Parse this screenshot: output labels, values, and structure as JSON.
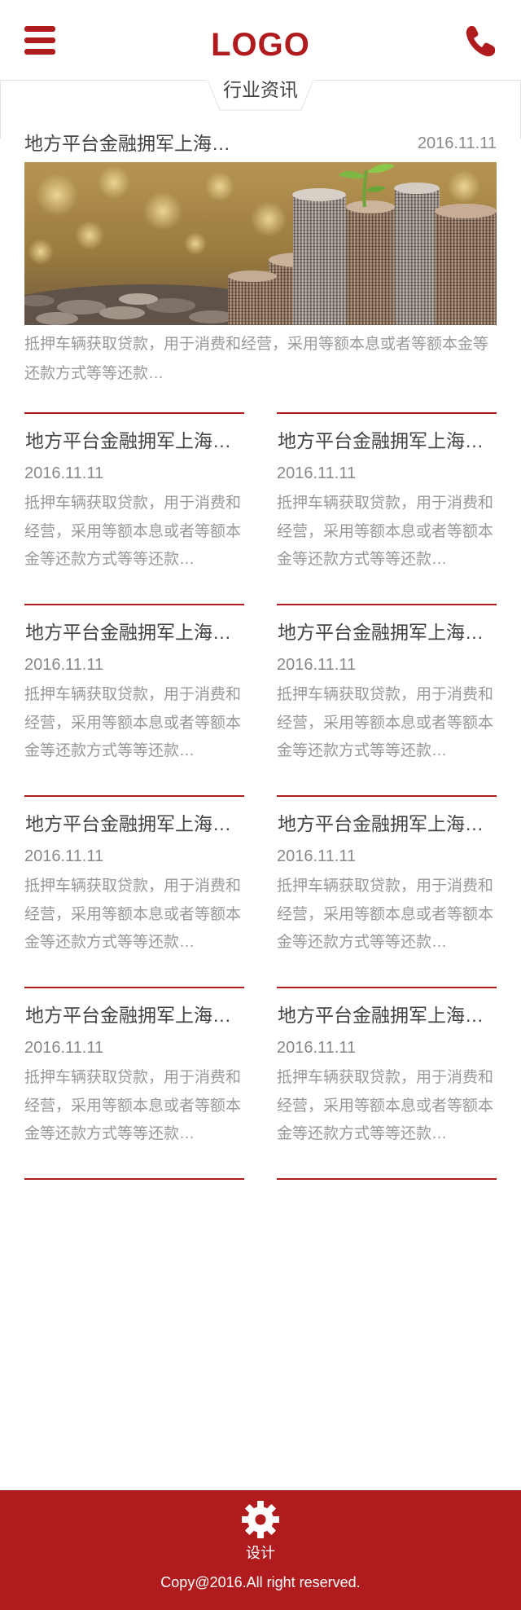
{
  "header": {
    "logo": "LOGO",
    "menu_icon": "hamburger-menu-icon",
    "phone_icon": "phone-icon"
  },
  "section": {
    "title": "行业资讯"
  },
  "featured": {
    "title": "地方平台金融拥军上海…",
    "date": "2016.11.11",
    "description": "抵押车辆获取贷款，用于消费和经营，采用等额本息或者等额本金等还款方式等等还款…",
    "image": "coins-with-plant-photo"
  },
  "articles": [
    {
      "title": "地方平台金融拥军上海…",
      "date": "2016.11.11",
      "description": "抵押车辆获取贷款，用于消费和经营，采用等额本息或者等额本金等还款方式等等还款…"
    },
    {
      "title": "地方平台金融拥军上海…",
      "date": "2016.11.11",
      "description": "抵押车辆获取贷款，用于消费和经营，采用等额本息或者等额本金等还款方式等等还款…"
    },
    {
      "title": "地方平台金融拥军上海…",
      "date": "2016.11.11",
      "description": "抵押车辆获取贷款，用于消费和经营，采用等额本息或者等额本金等还款方式等等还款…"
    },
    {
      "title": "地方平台金融拥军上海…",
      "date": "2016.11.11",
      "description": "抵押车辆获取贷款，用于消费和经营，采用等额本息或者等额本金等还款方式等等还款…"
    },
    {
      "title": "地方平台金融拥军上海…",
      "date": "2016.11.11",
      "description": "抵押车辆获取贷款，用于消费和经营，采用等额本息或者等额本金等还款方式等等还款…"
    },
    {
      "title": "地方平台金融拥军上海…",
      "date": "2016.11.11",
      "description": "抵押车辆获取贷款，用于消费和经营，采用等额本息或者等额本金等还款方式等等还款…"
    },
    {
      "title": "地方平台金融拥军上海…",
      "date": "2016.11.11",
      "description": "抵押车辆获取贷款，用于消费和经营，采用等额本息或者等额本金等还款方式等等还款…"
    },
    {
      "title": "地方平台金融拥军上海…",
      "date": "2016.11.11",
      "description": "抵押车辆获取贷款，用于消费和经营，采用等额本息或者等额本金等还款方式等等还款…"
    }
  ],
  "footer": {
    "icon": "gear-icon",
    "label": "设计",
    "copyright": "Copy@2016.All right reserved."
  },
  "colors": {
    "brand": "#b01c1e",
    "text": "#444444",
    "muted": "#999999"
  }
}
